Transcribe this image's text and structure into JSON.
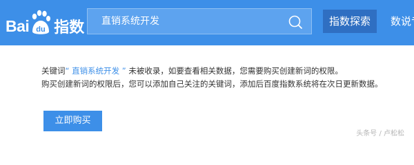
{
  "brand": {
    "logo_text_bai": "Bai",
    "logo_text_du": "du",
    "logo_text_product": "指数"
  },
  "search": {
    "value": "直销系统开发",
    "icon": "search-icon"
  },
  "nav": {
    "active_label": "指数探索",
    "next_label": "数说专"
  },
  "notice": {
    "prefix": "关键词",
    "open_quote": "“",
    "keyword": "直销系统开发",
    "close_quote": "”",
    "line1_suffix": "未被收录，如要查看相关数据，您需要购买创建新词的权限。",
    "line2": "购买创建新词的权限后，您可以添加自己关注的关键词，添加后百度指数系统将在次日更新数据。"
  },
  "actions": {
    "buy_label": "立即购买"
  },
  "watermark": {
    "text": "头条号 / 卢松松"
  },
  "colors": {
    "header_bg": "#3d8fe8",
    "active_nav_bg": "#2f6fc2",
    "accent": "#3d8fe8",
    "text": "#333333"
  }
}
